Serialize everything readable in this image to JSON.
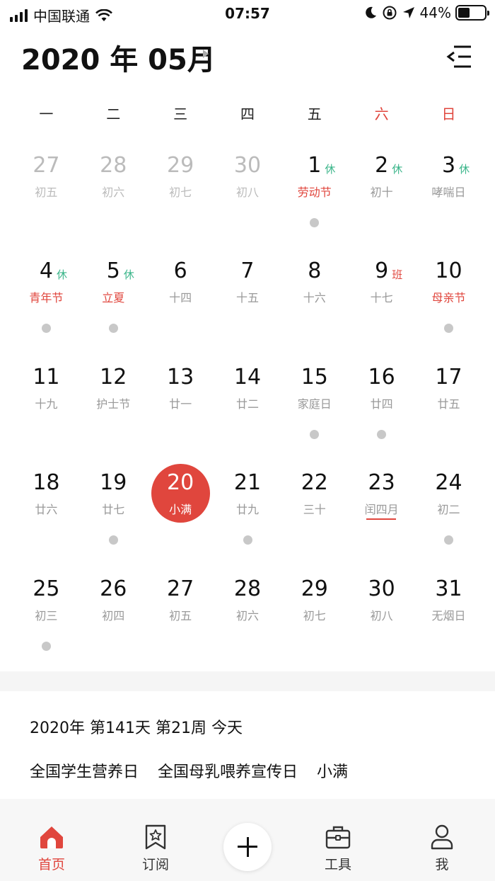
{
  "status_bar": {
    "carrier": "中国联通",
    "time": "07:57",
    "battery_percent": "44%",
    "battery_level": 0.44
  },
  "header": {
    "month_title": "2020 年 05月"
  },
  "weekdays": [
    "一",
    "二",
    "三",
    "四",
    "五",
    "六",
    "日"
  ],
  "calendar": {
    "weeks": [
      [
        {
          "day": "27",
          "lunar": "初五",
          "other": true
        },
        {
          "day": "28",
          "lunar": "初六",
          "other": true
        },
        {
          "day": "29",
          "lunar": "初七",
          "other": true
        },
        {
          "day": "30",
          "lunar": "初八",
          "other": true
        },
        {
          "day": "1",
          "lunar": "劳动节",
          "lunar_red": true,
          "tag": "休",
          "tag_type": "rest",
          "dot": true
        },
        {
          "day": "2",
          "lunar": "初十",
          "tag": "休",
          "tag_type": "rest"
        },
        {
          "day": "3",
          "lunar": "哮喘日",
          "tag": "休",
          "tag_type": "rest"
        }
      ],
      [
        {
          "day": "4",
          "lunar": "青年节",
          "lunar_red": true,
          "tag": "休",
          "tag_type": "rest",
          "dot": true
        },
        {
          "day": "5",
          "lunar": "立夏",
          "lunar_red": true,
          "tag": "休",
          "tag_type": "rest",
          "dot": true
        },
        {
          "day": "6",
          "lunar": "十四"
        },
        {
          "day": "7",
          "lunar": "十五"
        },
        {
          "day": "8",
          "lunar": "十六"
        },
        {
          "day": "9",
          "lunar": "十七",
          "tag": "班",
          "tag_type": "work"
        },
        {
          "day": "10",
          "lunar": "母亲节",
          "lunar_red": true,
          "dot": true
        }
      ],
      [
        {
          "day": "11",
          "lunar": "十九"
        },
        {
          "day": "12",
          "lunar": "护士节"
        },
        {
          "day": "13",
          "lunar": "廿一"
        },
        {
          "day": "14",
          "lunar": "廿二"
        },
        {
          "day": "15",
          "lunar": "家庭日",
          "dot": true
        },
        {
          "day": "16",
          "lunar": "廿四",
          "dot": true
        },
        {
          "day": "17",
          "lunar": "廿五"
        }
      ],
      [
        {
          "day": "18",
          "lunar": "廿六"
        },
        {
          "day": "19",
          "lunar": "廿七",
          "dot": true
        },
        {
          "day": "20",
          "lunar": "小满",
          "today": true
        },
        {
          "day": "21",
          "lunar": "廿九",
          "dot": true
        },
        {
          "day": "22",
          "lunar": "三十"
        },
        {
          "day": "23",
          "lunar": "闰四月",
          "underline": true
        },
        {
          "day": "24",
          "lunar": "初二",
          "dot": true
        }
      ],
      [
        {
          "day": "25",
          "lunar": "初三",
          "dot": true
        },
        {
          "day": "26",
          "lunar": "初四"
        },
        {
          "day": "27",
          "lunar": "初五"
        },
        {
          "day": "28",
          "lunar": "初六"
        },
        {
          "day": "29",
          "lunar": "初七"
        },
        {
          "day": "30",
          "lunar": "初八"
        },
        {
          "day": "31",
          "lunar": "无烟日"
        }
      ]
    ]
  },
  "info": {
    "summary": "2020年 第141天 第21周 今天",
    "events": [
      "全国学生营养日",
      "全国母乳喂养宣传日",
      "小满"
    ]
  },
  "tabbar": {
    "home": "首页",
    "subscribe": "订阅",
    "tools": "工具",
    "me": "我"
  },
  "colors": {
    "accent": "#e0463d",
    "rest_tag": "#3bb58a",
    "muted": "#999999",
    "dot": "#c8c8c8"
  },
  "icons": [
    "signal-icon",
    "wifi-icon",
    "moon-icon",
    "rotation-lock-icon",
    "location-arrow-icon",
    "battery-icon",
    "menu-collapse-icon",
    "home-icon",
    "bookmark-star-icon",
    "plus-icon",
    "toolbox-icon",
    "person-icon"
  ]
}
